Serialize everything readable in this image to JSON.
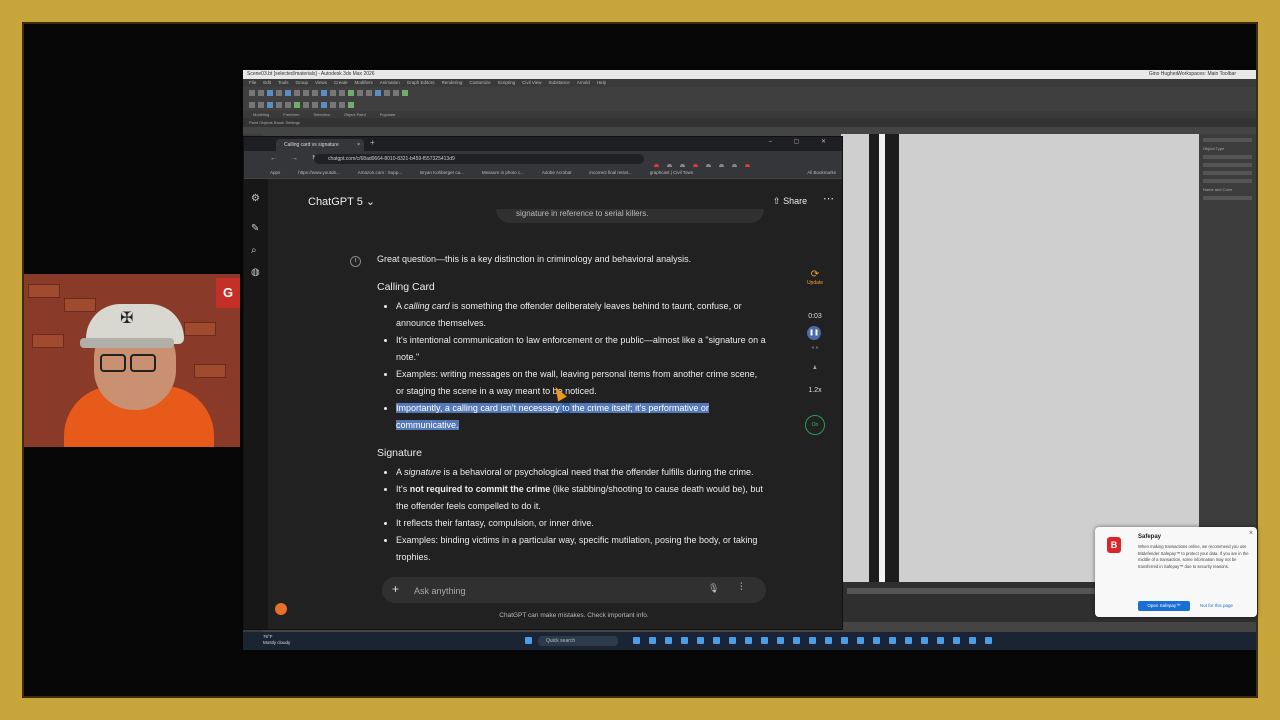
{
  "max": {
    "title": "Scene03.bt [selected/materials] - Autodesk 3ds Max 2026",
    "user": "Gino Hughes",
    "workspace": "Workspaces: Main Toolbar",
    "menu": [
      "File",
      "Edit",
      "Tools",
      "Group",
      "Views",
      "Create",
      "Modifiers",
      "Animation",
      "Graph Editors",
      "Rendering",
      "Customize",
      "Scripting",
      "Civil View",
      "Substance",
      "Arnold",
      "Help"
    ],
    "ribbon": [
      "Modeling",
      "Freeform",
      "Selection",
      "Object Paint",
      "Populate"
    ],
    "sub": "Paint Objects   Brush Settings",
    "right_panel": [
      "Object Type",
      "Name and Color"
    ]
  },
  "taskbar": {
    "weather_temp": "76°F",
    "weather_desc": "Mostly cloudy",
    "search": "Quick search"
  },
  "chrome": {
    "tab_title": "Calling card vs signature",
    "url": "chatgpt.com/c/68ad0664-8010-8321-b459-f557325413d9",
    "bookmarks": [
      "Apps",
      "https://www.youtub...",
      "Amazon.com : Supp...",
      "Bryan Kohberger ca...",
      "Measure in photo c...",
      "Adobe Acrobat",
      "incorrect final retrat...",
      "graphcast | Civil Town"
    ],
    "all_bookmarks": "All Bookmarks"
  },
  "chat": {
    "model": "ChatGPT 5",
    "share": "Share",
    "prev_message": "signature in reference to serial killers.",
    "intro": "Great question—this is a key distinction in criminology and behavioral analysis.",
    "sections": [
      {
        "heading": "Calling Card",
        "b1_pre": "A ",
        "b1_em": "calling card",
        "b1_post": " is something the offender deliberately leaves behind to taunt, confuse, or announce themselves.",
        "b2": "It's intentional communication to law enforcement or the public—almost like a \"signature on a note.\"",
        "b3": "Examples: writing messages on the wall, leaving personal items from another crime scene, or staging the scene in a way meant to be noticed.",
        "b4_pre": "Importantly, a calling card isn't necessary ",
        "b4_sel": "to",
        "b4_post": " the crime itself; it's performative or communicative."
      },
      {
        "heading": "Signature",
        "b1_pre": "A ",
        "b1_em": "signature",
        "b1_post": " is a behavioral or psychological need that the offender fulfills during the crime.",
        "b2_pre": "It's ",
        "b2_strong": "not required to commit the crime",
        "b2_post": " (like stabbing/shooting to cause death would be), but the offender feels compelled to do it.",
        "b3": "It reflects their fantasy, compulsion, or inner drive.",
        "b4": "Examples: binding victims in a particular way, specific mutilation, posing the body, or taking trophies."
      }
    ],
    "composer_placeholder": "Ask anything",
    "disclaimer": "ChatGPT can make mistakes. Check important info."
  },
  "voice": {
    "update": "Update",
    "timer": "0:03",
    "speed": "1.2x",
    "on": "On"
  },
  "webcam": {
    "sign": "G"
  },
  "safepay": {
    "title": "Safepay",
    "body": "When making transactions online, we recommend you use Bitdefender Safepay™ to protect your data. If you are in the middle of a transaction, some information may not be transferred in Safepay™ due to security reasons.",
    "open": "Open Safepay™",
    "not_site": "Not for this page"
  },
  "colors": {
    "frame": "#c7a53a",
    "chat_bg": "#212121",
    "highlight": "#5478b8",
    "accent_orange": "#e8702a"
  }
}
